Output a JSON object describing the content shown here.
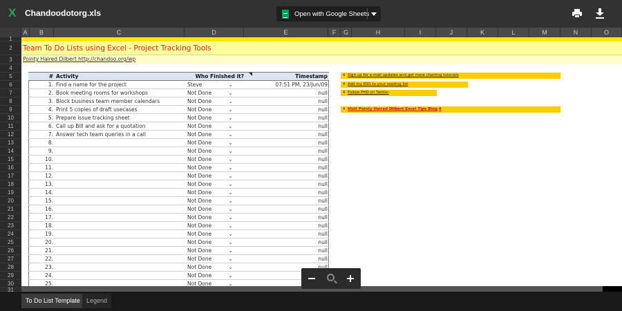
{
  "app": {
    "file_title": "Chandoodotorg.xls",
    "open_with_label": "Open with Google Sheets"
  },
  "colors": {
    "topbar": "#323232",
    "title_text": "#e02020",
    "title_fill": "#ffff99",
    "link_fill": "#ffcc00",
    "header_fill": "#dbe4f0"
  },
  "icons": [
    "excel-icon",
    "sheets-icon",
    "chevron-down-icon",
    "print-icon",
    "download-icon",
    "zoom-out-icon",
    "zoom-magnifier-icon",
    "zoom-in-icon"
  ],
  "columns": [
    "A",
    "B",
    "C",
    "D",
    "E",
    "F",
    "G",
    "H",
    "I",
    "J",
    "K",
    "L",
    "M",
    "N",
    "O"
  ],
  "rows": [
    "1",
    "2",
    "3",
    "4",
    "5",
    "6",
    "7",
    "8",
    "9",
    "10",
    "11",
    "12",
    "13",
    "14",
    "15",
    "16",
    "17",
    "18",
    "19",
    "20",
    "21",
    "22",
    "23",
    "24",
    "25",
    "26",
    "27",
    "28",
    "29",
    "30",
    "31"
  ],
  "sheet": {
    "title": "Team To Do Lists using Excel - Project Tracking Tools",
    "subtitle": "Pointy Haired Dilbert http://chandoo.org/wp"
  },
  "table": {
    "headers": [
      "#",
      "Activity",
      "Who Finished it?",
      "Timestamp"
    ],
    "rows": [
      {
        "num": "1.",
        "activity": "Find a name for the project",
        "who": "Steve",
        "ts": "07:51 PM, 23/Jun/09"
      },
      {
        "num": "2.",
        "activity": "Book meeting rooms for workshops",
        "who": "Not Done",
        "ts": "null"
      },
      {
        "num": "3.",
        "activity": "Block business team member calendars",
        "who": "Not Done",
        "ts": "null"
      },
      {
        "num": "4.",
        "activity": "Print 5 copies of draft usecases",
        "who": "Not Done",
        "ts": "null"
      },
      {
        "num": "5.",
        "activity": "Prepare issue tracking sheet",
        "who": "Not Done",
        "ts": "null"
      },
      {
        "num": "6.",
        "activity": "Call up Bill and ask for a quotation",
        "who": "Not Done",
        "ts": "null"
      },
      {
        "num": "7.",
        "activity": "Answer tech team queries in a call",
        "who": "Not Done",
        "ts": "null"
      },
      {
        "num": "8.",
        "activity": "",
        "who": "Not Done",
        "ts": "null"
      },
      {
        "num": "9.",
        "activity": "",
        "who": "Not Done",
        "ts": "null"
      },
      {
        "num": "10.",
        "activity": "",
        "who": "Not Done",
        "ts": "null"
      },
      {
        "num": "11.",
        "activity": "",
        "who": "Not Done",
        "ts": "null"
      },
      {
        "num": "12.",
        "activity": "",
        "who": "Not Done",
        "ts": "null"
      },
      {
        "num": "13.",
        "activity": "",
        "who": "Not Done",
        "ts": "null"
      },
      {
        "num": "14.",
        "activity": "",
        "who": "Not Done",
        "ts": "null"
      },
      {
        "num": "15.",
        "activity": "",
        "who": "Not Done",
        "ts": "null"
      },
      {
        "num": "16.",
        "activity": "",
        "who": "Not Done",
        "ts": "null"
      },
      {
        "num": "17.",
        "activity": "",
        "who": "Not Done",
        "ts": "null"
      },
      {
        "num": "18.",
        "activity": "",
        "who": "Not Done",
        "ts": "null"
      },
      {
        "num": "19.",
        "activity": "",
        "who": "Not Done",
        "ts": "null"
      },
      {
        "num": "20.",
        "activity": "",
        "who": "Not Done",
        "ts": "null"
      },
      {
        "num": "21.",
        "activity": "",
        "who": "Not Done",
        "ts": "null"
      },
      {
        "num": "22.",
        "activity": "",
        "who": "Not Done",
        "ts": "null"
      },
      {
        "num": "23.",
        "activity": "",
        "who": "Not Done",
        "ts": "null"
      },
      {
        "num": "24.",
        "activity": "",
        "who": "Not Done",
        "ts": "null"
      },
      {
        "num": "25.",
        "activity": "",
        "who": "Not Done",
        "ts": "null"
      }
    ]
  },
  "links": [
    {
      "text": "Sign up for e-mail updates and get more charting tutorials"
    },
    {
      "text": "Add my RSS to your reading list"
    },
    {
      "text": "Follow PHD on Twitter"
    },
    {
      "text": "Visit Pointy Haired Dilbert Excel Tips Blog"
    }
  ],
  "link_bullet": "4",
  "sheet_tabs": [
    "To Do List Template",
    "Legend"
  ]
}
